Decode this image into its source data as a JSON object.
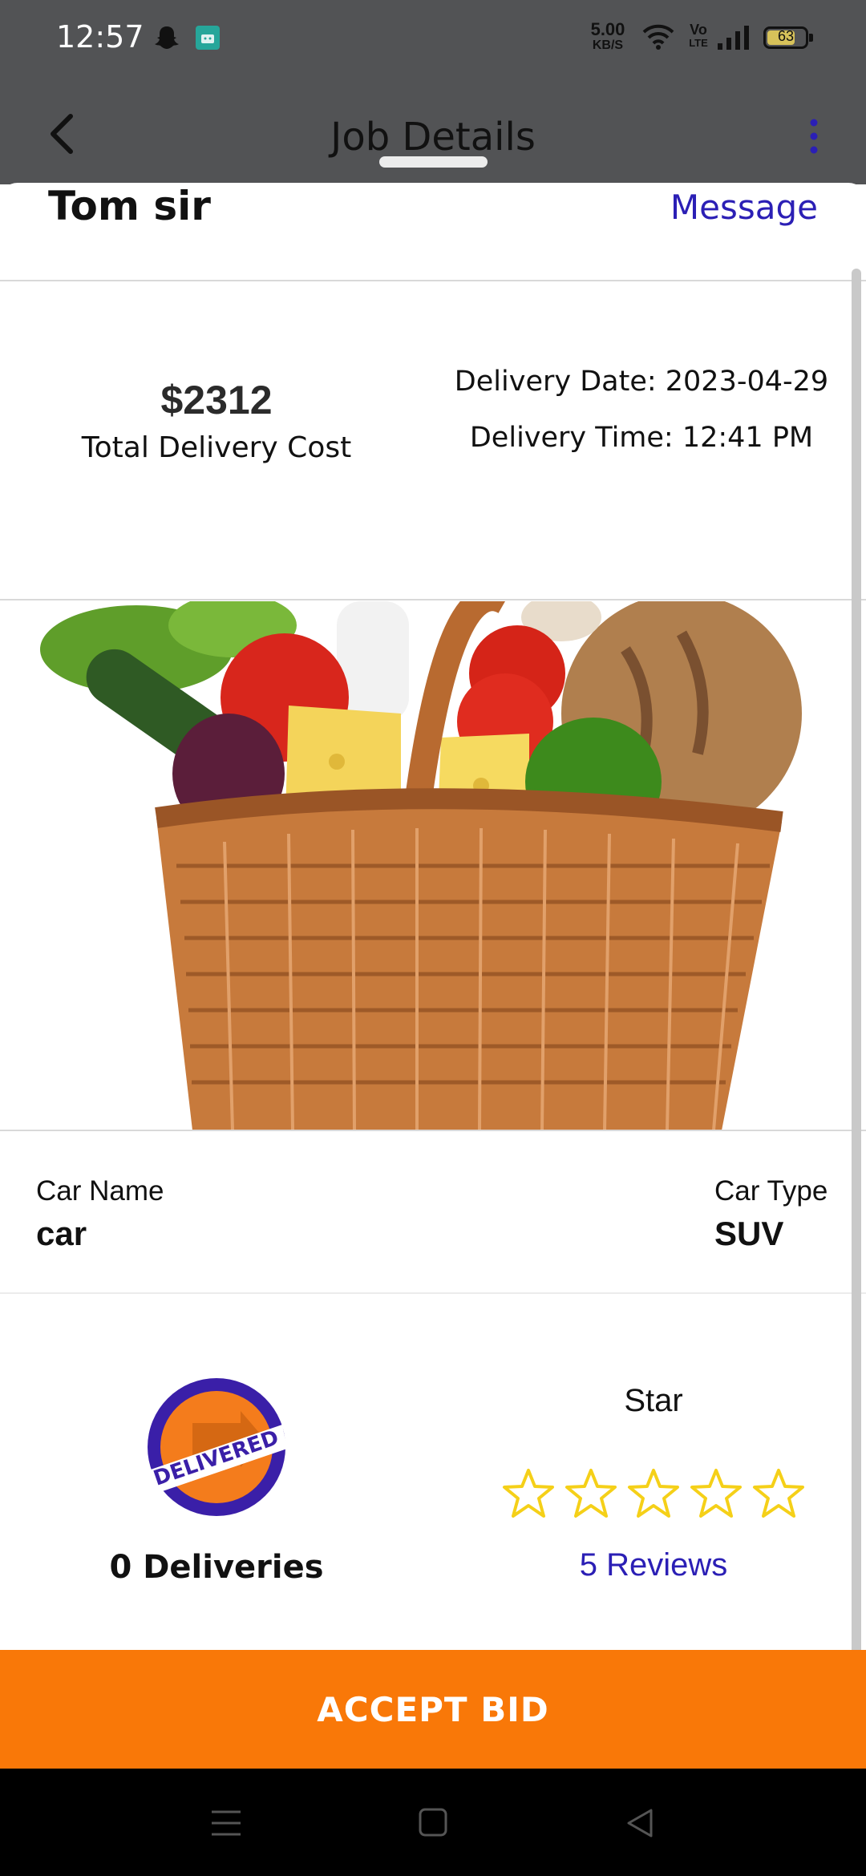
{
  "status_bar": {
    "time": "12:57",
    "net_speed_value": "5.00",
    "net_speed_unit": "KB/S",
    "volte_top": "Vo",
    "volte_bottom": "LTE",
    "battery": "63"
  },
  "header": {
    "title": "Job Details",
    "back_icon": "back-arrow-icon",
    "menu_icon": "more-vertical-icon"
  },
  "job": {
    "customer_name": "Tom sir",
    "message_label": "Message",
    "total_cost": "$2312",
    "total_cost_label": "Total Delivery Cost",
    "delivery_date": "Delivery Date: 2023-04-29",
    "delivery_time": "Delivery Time: 12:41 PM",
    "image": "grocery-basket-photo"
  },
  "car": {
    "name_label": "Car Name",
    "name_value": "car",
    "type_label": "Car Type",
    "type_value": "SUV"
  },
  "stats": {
    "badge_text": "DELIVERED",
    "deliveries": "0 Deliveries",
    "star_label": "Star",
    "star_count": 5,
    "rating_filled": 0,
    "reviews": "5 Reviews"
  },
  "actions": {
    "accept_label": "ACCEPT BID"
  },
  "colors": {
    "accent_orange": "#f97808",
    "link_blue": "#2b1fb5",
    "star_yellow": "#f5d018",
    "header_gray": "#525355"
  }
}
